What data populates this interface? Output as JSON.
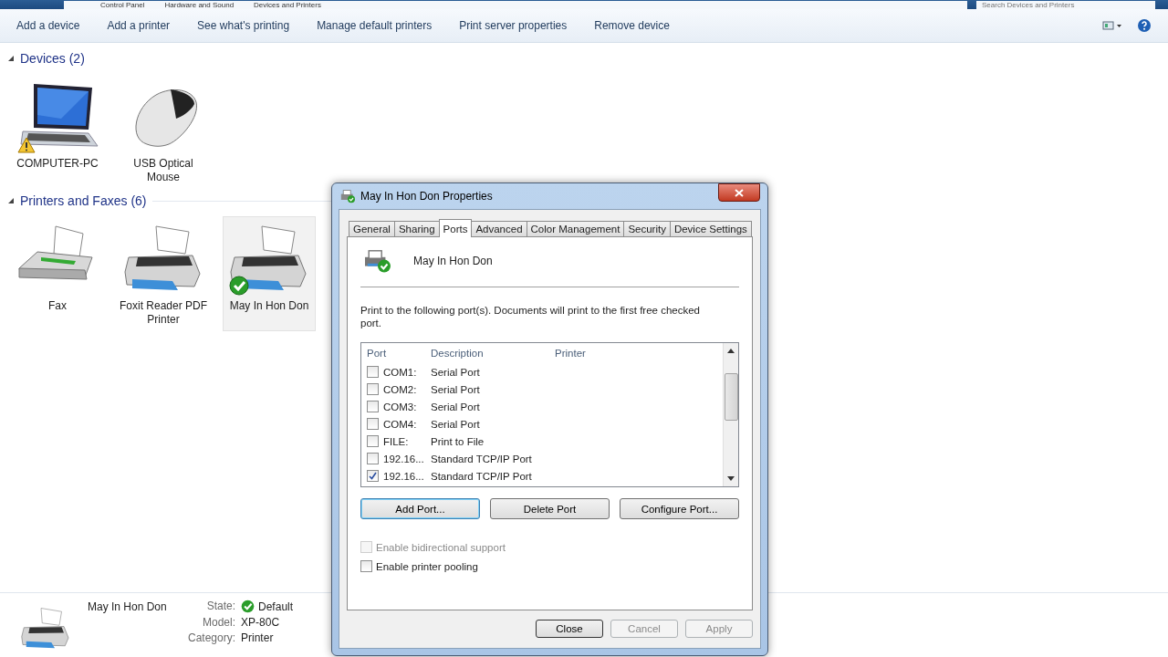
{
  "address_bar": {
    "breadcrumbs": [
      "Control Panel",
      "Hardware and Sound",
      "Devices and Printers"
    ],
    "search_placeholder": "Search Devices and Printers"
  },
  "toolbar": {
    "items": [
      "Add a device",
      "Add a printer",
      "See what's printing",
      "Manage default printers",
      "Print server properties",
      "Remove device"
    ]
  },
  "groups": [
    {
      "title": "Devices (2)",
      "expanded": true,
      "items": [
        {
          "label": "COMPUTER-PC",
          "kind": "laptop",
          "warning": true,
          "default": false,
          "selected": false
        },
        {
          "label": "USB Optical Mouse",
          "kind": "mouse",
          "warning": false,
          "default": false,
          "selected": false
        }
      ]
    },
    {
      "title": "Printers and Faxes (6)",
      "expanded": true,
      "items": [
        {
          "label": "Fax",
          "kind": "fax",
          "warning": false,
          "default": false,
          "selected": false
        },
        {
          "label": "Foxit Reader PDF Printer",
          "kind": "printer",
          "warning": false,
          "default": false,
          "selected": false
        },
        {
          "label": "May In Hon Don",
          "kind": "printer",
          "warning": false,
          "default": true,
          "selected": true
        }
      ]
    }
  ],
  "details": {
    "name": "May In Hon Don",
    "fields": [
      {
        "label": "State:",
        "value": "Default",
        "default": true
      },
      {
        "label": "Model:",
        "value": "XP-80C",
        "default": false
      },
      {
        "label": "Category:",
        "value": "Printer",
        "default": false
      }
    ]
  },
  "dialog": {
    "title": "May In Hon Don Properties",
    "tabs": [
      {
        "label": "General",
        "selected": false
      },
      {
        "label": "Sharing",
        "selected": false
      },
      {
        "label": "Ports",
        "selected": true
      },
      {
        "label": "Advanced",
        "selected": false
      },
      {
        "label": "Color Management",
        "selected": false
      },
      {
        "label": "Security",
        "selected": false
      },
      {
        "label": "Device Settings",
        "selected": false
      }
    ],
    "printer_name": "May In Hon Don",
    "instruction": "Print to the following port(s). Documents will print to the first free checked port.",
    "columns": [
      "Port",
      "Description",
      "Printer"
    ],
    "ports": [
      {
        "port": "COM1:",
        "description": "Serial Port",
        "checked": false
      },
      {
        "port": "COM2:",
        "description": "Serial Port",
        "checked": false
      },
      {
        "port": "COM3:",
        "description": "Serial Port",
        "checked": false
      },
      {
        "port": "COM4:",
        "description": "Serial Port",
        "checked": false
      },
      {
        "port": "FILE:",
        "description": "Print to File",
        "checked": false
      },
      {
        "port": "192.16...",
        "description": "Standard TCP/IP Port",
        "checked": false
      },
      {
        "port": "192.16...",
        "description": "Standard TCP/IP Port",
        "checked": true
      }
    ],
    "port_buttons": [
      {
        "label": "Add Port...",
        "selected": true
      },
      {
        "label": "Delete Port",
        "selected": false
      },
      {
        "label": "Configure Port...",
        "selected": false
      }
    ],
    "options": [
      {
        "label": "Enable bidirectional support",
        "checked": false,
        "disabled": true
      },
      {
        "label": "Enable printer pooling",
        "checked": false,
        "disabled": false
      }
    ],
    "buttons": [
      {
        "label": "Close",
        "disabled": false
      },
      {
        "label": "Cancel",
        "disabled": true
      },
      {
        "label": "Apply",
        "disabled": true
      }
    ]
  }
}
